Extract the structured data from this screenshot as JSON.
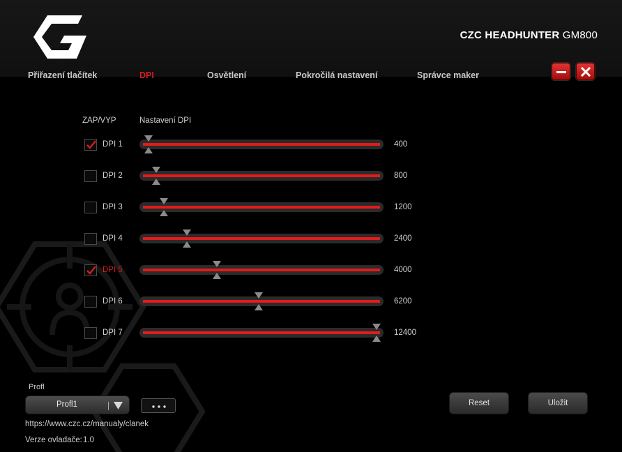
{
  "header": {
    "brand": "CZC HEADHUNTER",
    "model": "GM800",
    "logo_icon": "czc-g-logo",
    "tabs": [
      {
        "label": "Přiřazení tlačítek",
        "active": false
      },
      {
        "label": "DPI",
        "active": true
      },
      {
        "label": "Osvětlení",
        "active": false
      },
      {
        "label": "Pokročilá nastavení",
        "active": false
      },
      {
        "label": "Správce maker",
        "active": false
      }
    ],
    "window_buttons": {
      "minimize_icon": "minus-icon",
      "close_icon": "x-icon"
    }
  },
  "dpi_panel": {
    "col_onoff": "ZAP/VYP",
    "col_settings": "Nastavení DPI",
    "slider_min": 100,
    "slider_max": 12600,
    "levels": [
      {
        "name": "DPI 1",
        "value": "400",
        "checked": true,
        "highlighted": false
      },
      {
        "name": "DPI 2",
        "value": "800",
        "checked": false,
        "highlighted": false
      },
      {
        "name": "DPI 3",
        "value": "1200",
        "checked": false,
        "highlighted": false
      },
      {
        "name": "DPI 4",
        "value": "2400",
        "checked": false,
        "highlighted": false
      },
      {
        "name": "DPI 5",
        "value": "4000",
        "checked": true,
        "highlighted": true
      },
      {
        "name": "DPI 6",
        "value": "6200",
        "checked": false,
        "highlighted": false
      },
      {
        "name": "DPI 7",
        "value": "12400",
        "checked": false,
        "highlighted": false
      }
    ]
  },
  "footer": {
    "profile_label": "Profl",
    "profile_value": "Profl1",
    "more_label": "• • •",
    "reset_label": "Reset",
    "save_label": "Uložit",
    "manual_url": "https://www.czc.cz/manualy/clanek",
    "driver_version_label": "Verze ovladače:",
    "driver_version_value": "1.0"
  },
  "colors": {
    "accent": "#d21e1e",
    "slider_fill": "#e21b1b",
    "background": "#000000"
  }
}
